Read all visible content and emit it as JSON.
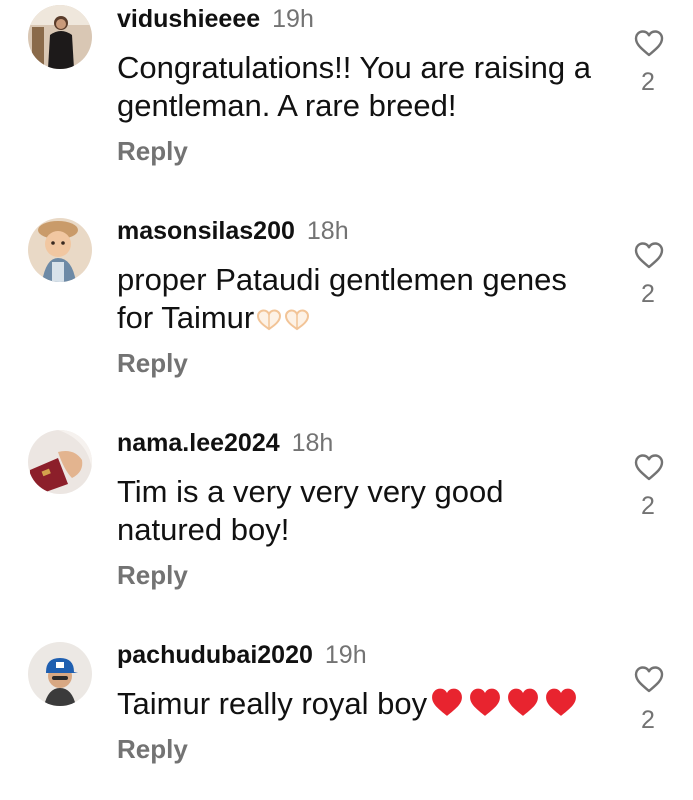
{
  "comments": [
    {
      "username": "vidushieeee",
      "time": "19h",
      "text": "Congratulations!! You are raising a gentleman. A rare breed!",
      "reply_label": "Reply",
      "like_count": "2",
      "avatar": "woman-standing-avatar"
    },
    {
      "username": "masonsilas200",
      "time": "18h",
      "text": "proper Pataudi gentlemen genes for Taimur",
      "emoji": [
        "heart-hands-emoji",
        "heart-hands-emoji"
      ],
      "reply_label": "Reply",
      "like_count": "2",
      "avatar": "toddler-avatar"
    },
    {
      "username": "nama.lee2024",
      "time": "18h",
      "text": "Tim is a very very very good natured boy!",
      "reply_label": "Reply",
      "like_count": "2",
      "avatar": "passport-avatar"
    },
    {
      "username": "pachudubai2020",
      "time": "19h",
      "text": "Taimur really royal boy",
      "emoji": [
        "red-heart-emoji",
        "red-heart-emoji",
        "red-heart-emoji",
        "red-heart-emoji"
      ],
      "reply_label": "Reply",
      "like_count": "2",
      "avatar": "man-blue-cap-avatar"
    }
  ],
  "colors": {
    "text": "#111111",
    "secondary": "#737373",
    "heart_red": "#e8242f",
    "heart_hands": "#f6d3ae"
  }
}
